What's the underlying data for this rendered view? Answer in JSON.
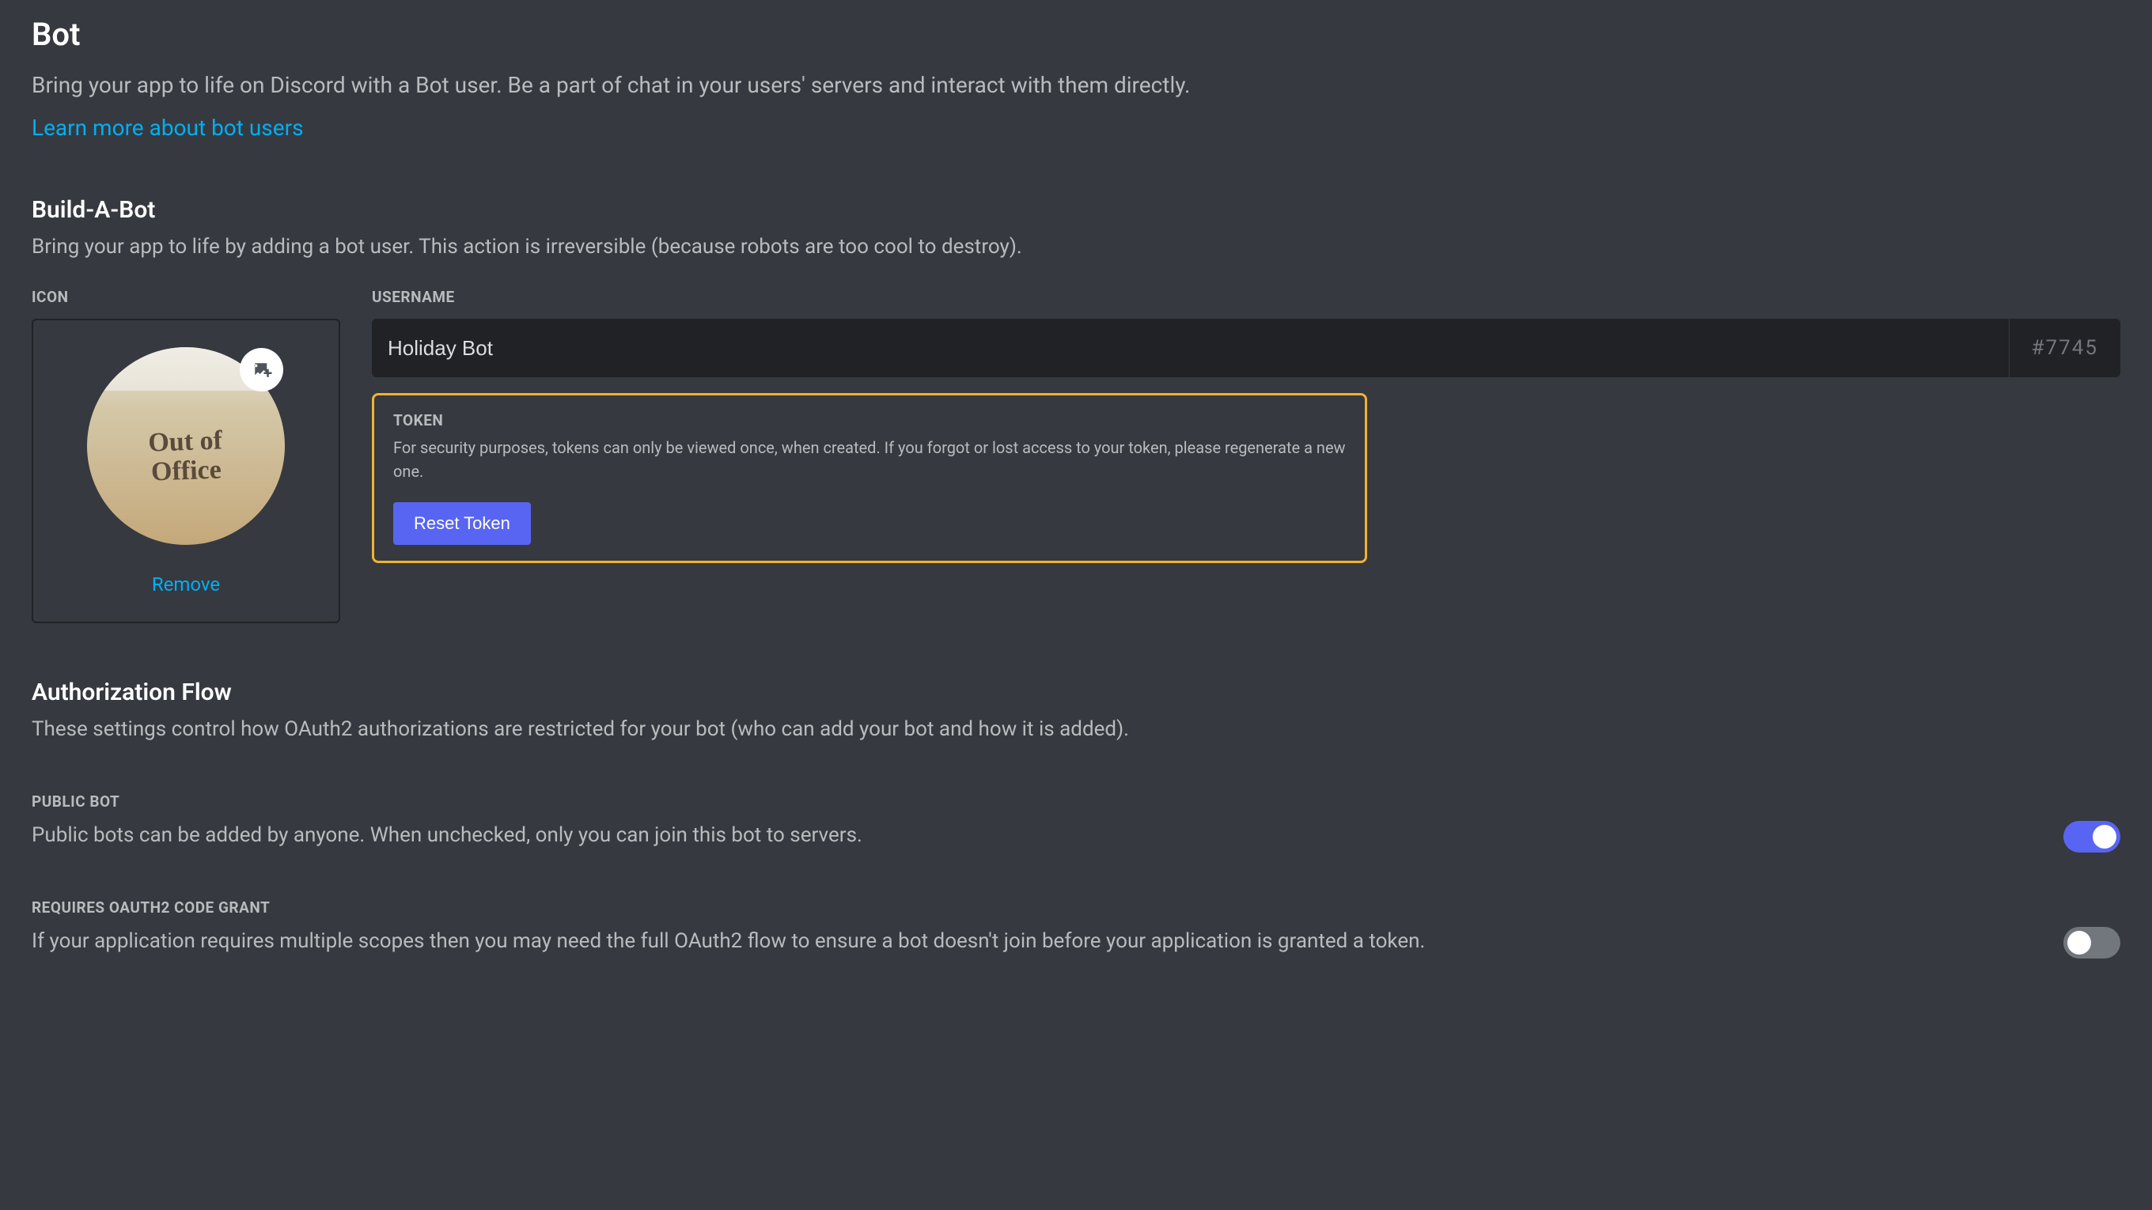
{
  "header": {
    "title": "Bot",
    "subtitle": "Bring your app to life on Discord with a Bot user. Be a part of chat in your users' servers and interact with them directly.",
    "learn_more": "Learn more about bot users"
  },
  "build": {
    "title": "Build-A-Bot",
    "desc": "Bring your app to life by adding a bot user. This action is irreversible (because robots are too cool to destroy).",
    "icon_label": "ICON",
    "avatar_line1": "Out of",
    "avatar_line2": "Office",
    "remove": "Remove",
    "username_label": "USERNAME",
    "username_value": "Holiday Bot",
    "discriminator": "#7745",
    "token": {
      "label": "TOKEN",
      "desc": "For security purposes, tokens can only be viewed once, when created. If you forgot or lost access to your token, please regenerate a new one.",
      "reset_btn": "Reset Token"
    }
  },
  "auth": {
    "title": "Authorization Flow",
    "desc": "These settings control how OAuth2 authorizations are restricted for your bot (who can add your bot and how it is added)."
  },
  "settings": {
    "public_bot": {
      "label": "PUBLIC BOT",
      "desc": "Public bots can be added by anyone. When unchecked, only you can join this bot to servers.",
      "enabled": true
    },
    "oauth_grant": {
      "label": "REQUIRES OAUTH2 CODE GRANT",
      "desc": "If your application requires multiple scopes then you may need the full OAuth2 flow to ensure a bot doesn't join before your application is granted a token.",
      "enabled": false
    }
  }
}
